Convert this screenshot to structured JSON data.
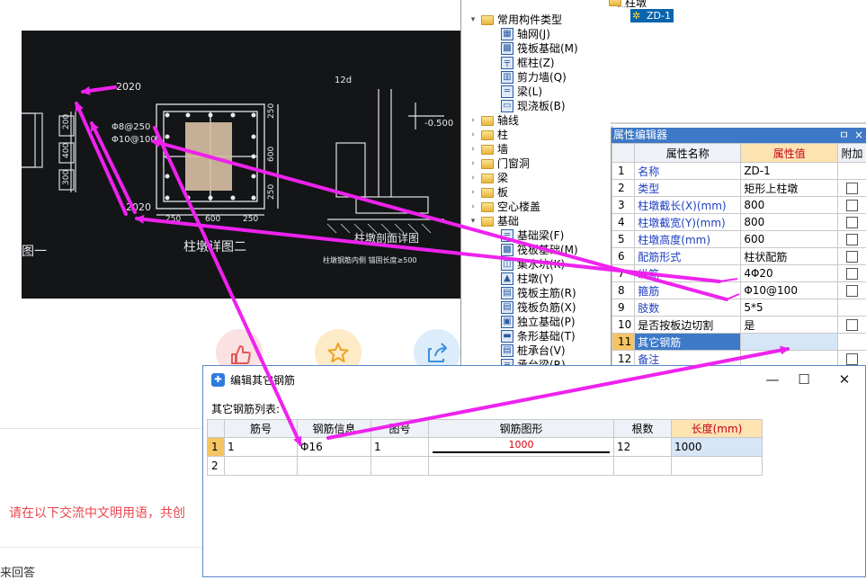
{
  "colors": {
    "accent": "#3d79c7",
    "arrow": "#ee22ee",
    "note": "#e8474e"
  },
  "photo": {
    "labels": {
      "top_left": "2020",
      "bar_spacing": "Φ8@250",
      "bar_spacing2": "Φ10@100",
      "dim_bottom": "2020",
      "dim_250": "250",
      "dim_600": "600",
      "dim_250b": "250",
      "right_250": "250",
      "right_600": "600",
      "right_250b": "250",
      "left_200": "200",
      "left_400": "400",
      "left_300": "300",
      "detail_12d": "12d",
      "elev": "-0.500",
      "caption_left": "图一",
      "caption_mid": "柱墩详图二",
      "caption_right": "柱墩剖面详图",
      "note": "柱墩钢筋内侧 锚固长度≥500"
    }
  },
  "reactions": [
    {
      "icon": "thumbs-up-icon"
    },
    {
      "icon": "star-icon"
    },
    {
      "icon": "share-icon"
    }
  ],
  "civil_note": "请在以下交流中文明用语，共创",
  "answer_text": "来回答",
  "tree": {
    "rows": [
      {
        "indent": 0,
        "expand": "▾",
        "icon": "folder",
        "label": "常用构件类型"
      },
      {
        "indent": 1,
        "expand": "",
        "icon": "grid",
        "label": "轴网(J)"
      },
      {
        "indent": 1,
        "expand": "",
        "icon": "raft",
        "label": "筏板基础(M)"
      },
      {
        "indent": 1,
        "expand": "",
        "icon": "column",
        "label": "框柱(Z)"
      },
      {
        "indent": 1,
        "expand": "",
        "icon": "wall",
        "label": "剪力墙(Q)"
      },
      {
        "indent": 1,
        "expand": "",
        "icon": "beam",
        "label": "梁(L)"
      },
      {
        "indent": 1,
        "expand": "",
        "icon": "slab",
        "label": "现浇板(B)"
      },
      {
        "indent": 0,
        "expand": "›",
        "icon": "folder",
        "label": "轴线"
      },
      {
        "indent": 0,
        "expand": "›",
        "icon": "folder",
        "label": "柱"
      },
      {
        "indent": 0,
        "expand": "›",
        "icon": "folder",
        "label": "墙"
      },
      {
        "indent": 0,
        "expand": "›",
        "icon": "folder",
        "label": "门窗洞"
      },
      {
        "indent": 0,
        "expand": "›",
        "icon": "folder",
        "label": "梁"
      },
      {
        "indent": 0,
        "expand": "›",
        "icon": "folder",
        "label": "板"
      },
      {
        "indent": 0,
        "expand": "›",
        "icon": "folder",
        "label": "空心楼盖"
      },
      {
        "indent": 0,
        "expand": "▾",
        "icon": "folder",
        "label": "基础"
      },
      {
        "indent": 1,
        "expand": "",
        "icon": "beam",
        "label": "基础梁(F)"
      },
      {
        "indent": 1,
        "expand": "",
        "icon": "raft",
        "label": "筏板基础(M)"
      },
      {
        "indent": 1,
        "expand": "",
        "icon": "pit",
        "label": "集水坑(K)"
      },
      {
        "indent": 1,
        "expand": "",
        "icon": "pier",
        "label": "柱墩(Y)"
      },
      {
        "indent": 1,
        "expand": "",
        "icon": "rebar",
        "label": "筏板主筋(R)"
      },
      {
        "indent": 1,
        "expand": "",
        "icon": "rebar",
        "label": "筏板负筋(X)"
      },
      {
        "indent": 1,
        "expand": "",
        "icon": "footing",
        "label": "独立基础(P)"
      },
      {
        "indent": 1,
        "expand": "",
        "icon": "strip",
        "label": "条形基础(T)"
      },
      {
        "indent": 1,
        "expand": "",
        "icon": "pile",
        "label": "桩承台(V)"
      },
      {
        "indent": 1,
        "expand": "",
        "icon": "beam",
        "label": "承台梁(R)"
      }
    ]
  },
  "top_tree": {
    "parent": "柱墩",
    "child": "ZD-1"
  },
  "prop": {
    "title": "属性编辑器",
    "pin": "ㅁ",
    "close": "×",
    "headers": [
      "",
      "属性名称",
      "属性值",
      "附加"
    ],
    "rows": [
      {
        "n": "1",
        "name": "名称",
        "val": "ZD-1",
        "extra": "",
        "plain": false
      },
      {
        "n": "2",
        "name": "类型",
        "val": "矩形上柱墩",
        "extra": "cb",
        "plain": false
      },
      {
        "n": "3",
        "name": "柱墩截长(X)(mm)",
        "val": "800",
        "extra": "cb",
        "plain": false
      },
      {
        "n": "4",
        "name": "柱墩截宽(Y)(mm)",
        "val": "800",
        "extra": "cb",
        "plain": false
      },
      {
        "n": "5",
        "name": "柱墩高度(mm)",
        "val": "600",
        "extra": "cb",
        "plain": false
      },
      {
        "n": "6",
        "name": "配筋形式",
        "val": "柱状配筋",
        "extra": "cb",
        "plain": false
      },
      {
        "n": "7",
        "name": "纵筋",
        "val": "4Φ20",
        "extra": "cb",
        "plain": false
      },
      {
        "n": "8",
        "name": "箍筋",
        "val": "Φ10@100",
        "extra": "cb",
        "plain": false
      },
      {
        "n": "9",
        "name": "肢数",
        "val": "5*5",
        "extra": "",
        "plain": false
      },
      {
        "n": "10",
        "name": "是否按板边切割",
        "val": "是",
        "extra": "cb",
        "plain": true
      },
      {
        "n": "11",
        "name": "其它钢筋",
        "val": "",
        "extra": "",
        "plain": false,
        "sel": true
      },
      {
        "n": "12",
        "name": "备注",
        "val": "",
        "extra": "cb",
        "plain": false
      }
    ]
  },
  "dialog": {
    "title": "编辑其它钢筋",
    "label": "其它钢筋列表:",
    "headers": [
      "",
      "筋号",
      "钢筋信息",
      "图号",
      "钢筋图形",
      "根数",
      "长度(mm)"
    ],
    "rows": [
      {
        "n": "1",
        "jin": "1",
        "info": "Φ16",
        "tu": "1",
        "shape": "1000",
        "count": "12",
        "len": "1000"
      },
      {
        "n": "2",
        "jin": "",
        "info": "",
        "tu": "",
        "shape": "",
        "count": "",
        "len": ""
      }
    ],
    "min": "—",
    "max": "☐",
    "close": "✕"
  }
}
